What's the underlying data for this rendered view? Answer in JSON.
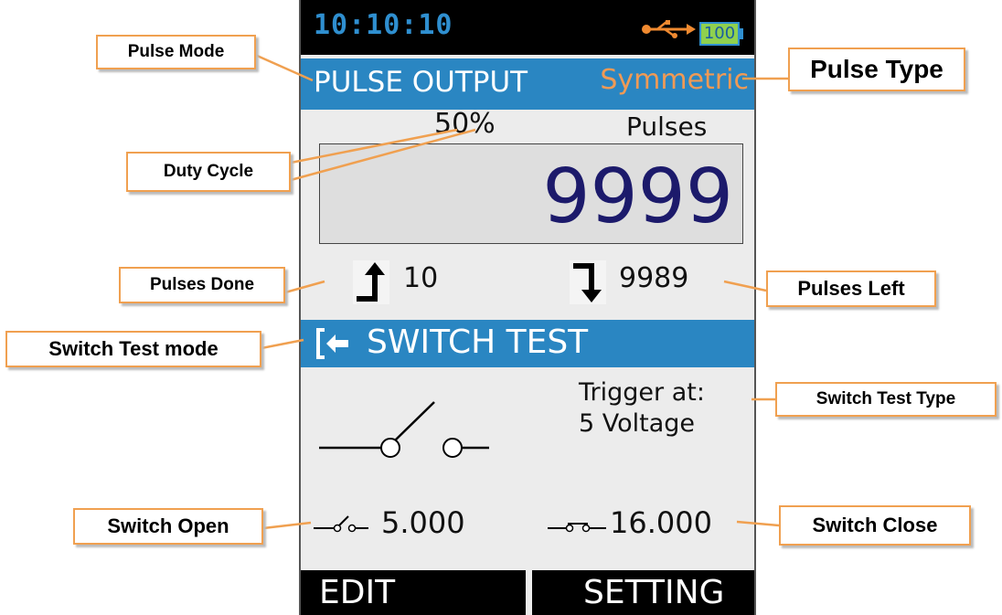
{
  "status_bar": {
    "time": "10:10:10",
    "battery_level": "100",
    "usb_icon": "usb-icon"
  },
  "pulse_header": {
    "mode_title": "PULSE OUTPUT",
    "pulse_type": "Symmetric"
  },
  "duty_cycle": "50%",
  "pulses_label": "Pulses",
  "pulse_count": "9999",
  "pulses_done": "10",
  "pulses_left": "9989",
  "switch_header": {
    "title": "SWITCH TEST",
    "icon": "switch-test-mode-icon"
  },
  "trigger": {
    "line1": "Trigger at:",
    "line2": "5 Voltage"
  },
  "switch_open_value": "5.000",
  "switch_close_value": "16.000",
  "softkeys": {
    "edit": "EDIT",
    "setting": "SETTING"
  },
  "callouts": {
    "pulse_mode": "Pulse Mode",
    "pulse_type": "Pulse Type",
    "duty_cycle": "Duty Cycle",
    "pulses_done": "Pulses Done",
    "pulses_left": "Pulses Left",
    "switch_test_mode": "Switch Test mode",
    "switch_test_type": "Switch Test Type",
    "switch_open": "Switch Open",
    "switch_close": "Switch Close"
  },
  "colors": {
    "accent_blue": "#2a86c2",
    "pulse_type_orange": "#f09a55",
    "count_navy": "#1c1a6b",
    "callout_border": "#f0a050"
  }
}
